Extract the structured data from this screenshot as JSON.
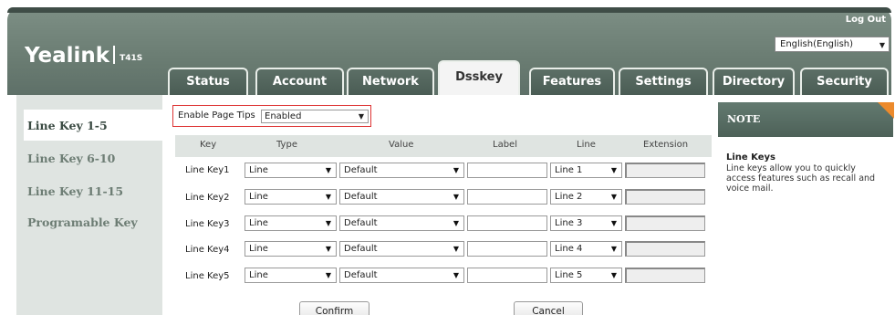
{
  "header": {
    "logo_brand": "Yealink",
    "logo_model": "T41S",
    "logout": "Log Out",
    "language": "English(English)"
  },
  "tabs": [
    {
      "label": "Status"
    },
    {
      "label": "Account"
    },
    {
      "label": "Network"
    },
    {
      "label": "Dsskey",
      "active": true
    },
    {
      "label": "Features"
    },
    {
      "label": "Settings"
    },
    {
      "label": "Directory"
    },
    {
      "label": "Security"
    }
  ],
  "sidebar": {
    "items": [
      {
        "label": "Line Key 1-5",
        "active": true
      },
      {
        "label": "Line Key 6-10"
      },
      {
        "label": "Line Key 11-15"
      },
      {
        "label": "Programable Key"
      }
    ]
  },
  "page_tips": {
    "label": "Enable Page Tips",
    "value": "Enabled"
  },
  "table": {
    "headers": [
      "Key",
      "Type",
      "Value",
      "Label",
      "Line",
      "Extension"
    ],
    "rows": [
      {
        "key": "Line Key1",
        "type": "Line",
        "value": "Default",
        "label": "",
        "line": "Line 1",
        "extension": ""
      },
      {
        "key": "Line Key2",
        "type": "Line",
        "value": "Default",
        "label": "",
        "line": "Line 2",
        "extension": ""
      },
      {
        "key": "Line Key3",
        "type": "Line",
        "value": "Default",
        "label": "",
        "line": "Line 3",
        "extension": ""
      },
      {
        "key": "Line Key4",
        "type": "Line",
        "value": "Default",
        "label": "",
        "line": "Line 4",
        "extension": ""
      },
      {
        "key": "Line Key5",
        "type": "Line",
        "value": "Default",
        "label": "",
        "line": "Line 5",
        "extension": ""
      }
    ]
  },
  "buttons": {
    "confirm": "Confirm",
    "cancel": "Cancel"
  },
  "note": {
    "title": "NOTE",
    "heading": "Line Keys",
    "text": "Line keys allow you to quickly access features such as recall and voice mail."
  },
  "colors": {
    "header": "#6a7c72",
    "sidebar": "#dfe4e1",
    "highlight_border": "#dd3333",
    "note_corner": "#ec8a2c"
  }
}
